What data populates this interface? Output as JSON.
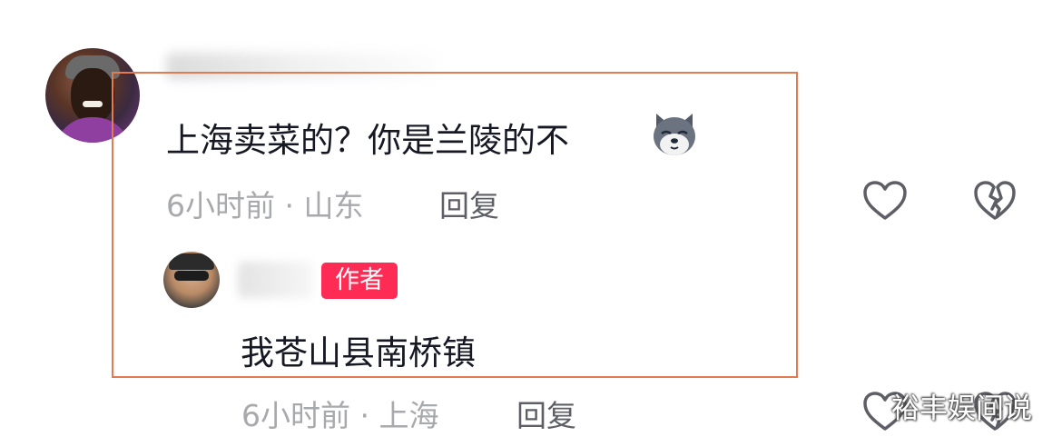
{
  "comment": {
    "text": "上海卖菜的？你是兰陵的不",
    "emoji": "dog-emoji",
    "meta": "6小时前 · 山东",
    "reply_label": "回复"
  },
  "reply": {
    "author_badge": "作者",
    "text": "我苍山县南桥镇",
    "meta": "6小时前 · 上海",
    "reply_label": "回复"
  },
  "watermark": "裕丰娱间说",
  "colors": {
    "highlight_border": "#e47a52",
    "author_badge": "#fe2c55",
    "text_primary": "#161823",
    "text_secondary": "#a8a9ad"
  }
}
